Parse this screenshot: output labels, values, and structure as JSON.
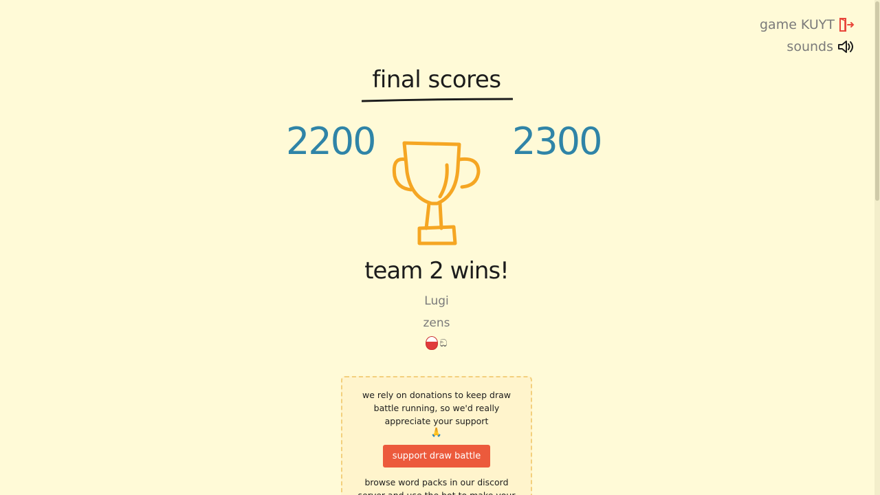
{
  "controls": {
    "game_label": "game KUYT",
    "exit_icon": "exit-door-icon",
    "sounds_label": "sounds",
    "sound_icon": "speaker-icon"
  },
  "title": "final scores",
  "scores": {
    "team1": "2200",
    "team2": "2300"
  },
  "trophy_icon": "trophy-icon",
  "winner_text": "team 2 wins!",
  "winning_players": [
    "Lugi",
    "zens"
  ],
  "player_emoji": [
    "ball-icon",
    "ඞ"
  ],
  "donation": {
    "text": "we rely on donations to keep draw battle running, so we'd really appreciate your support",
    "pray_emoji": "🙏",
    "button_label": "support draw battle",
    "discord_text": "browse word packs in our discord server and use the bot to make your own!"
  },
  "colors": {
    "background": "#fffad7",
    "score": "#2f84a7",
    "trophy": "#f5a623",
    "button": "#ec5a3c",
    "exit_icon": "#e8463b"
  }
}
